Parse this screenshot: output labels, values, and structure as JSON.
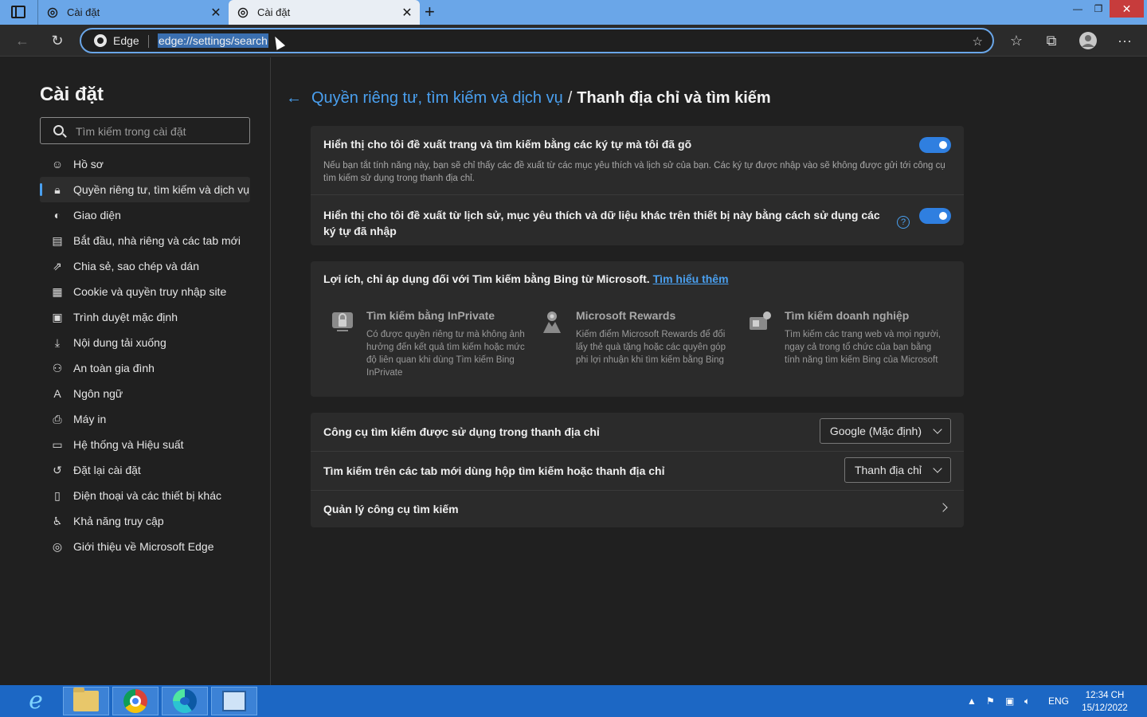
{
  "browser": {
    "tabs": [
      {
        "title": "Cài đặt",
        "active": false
      },
      {
        "title": "Cài đặt",
        "active": true
      }
    ],
    "address": {
      "brand": "Edge",
      "url": "edge://settings/search"
    }
  },
  "sidebar": {
    "title": "Cài đặt",
    "search_placeholder": "Tìm kiếm trong cài đặt",
    "items": [
      {
        "label": "Hồ sơ",
        "icon": "profile-icon"
      },
      {
        "label": "Quyền riêng tư, tìm kiếm và dịch vụ",
        "icon": "lock-icon",
        "selected": true
      },
      {
        "label": "Giao diện",
        "icon": "palette-icon"
      },
      {
        "label": "Bắt đầu, nhà riêng và các tab mới",
        "icon": "start-page-icon"
      },
      {
        "label": "Chia sẻ, sao chép và dán",
        "icon": "share-icon"
      },
      {
        "label": "Cookie và quyền truy nhập site",
        "icon": "cookie-icon"
      },
      {
        "label": "Trình duyệt mặc định",
        "icon": "default-browser-icon"
      },
      {
        "label": "Nội dung tải xuống",
        "icon": "download-icon"
      },
      {
        "label": "An toàn gia đình",
        "icon": "family-icon"
      },
      {
        "label": "Ngôn ngữ",
        "icon": "language-icon"
      },
      {
        "label": "Máy in",
        "icon": "printer-icon"
      },
      {
        "label": "Hệ thống và Hiệu suất",
        "icon": "laptop-icon"
      },
      {
        "label": "Đặt lại cài đặt",
        "icon": "reset-icon"
      },
      {
        "label": "Điện thoại và các thiết bị khác",
        "icon": "phone-icon"
      },
      {
        "label": "Khả năng truy cập",
        "icon": "accessibility-icon"
      },
      {
        "label": "Giới thiệu về Microsoft Edge",
        "icon": "edge-logo-icon"
      }
    ]
  },
  "main": {
    "breadcrumb": {
      "parent": "Quyền riêng tư, tìm kiếm và dịch vụ",
      "separator": "/",
      "current": "Thanh địa chỉ và tìm kiếm"
    },
    "suggestions": [
      {
        "title": "Hiển thị cho tôi đề xuất trang và tìm kiếm bằng các ký tự mà tôi đã gõ",
        "description": "Nếu bạn tắt tính năng này, bạn sẽ chỉ thấy các đề xuất từ các mục yêu thích và lịch sử của bạn. Các ký tự được nhập vào sẽ không được gửi tới công cụ tìm kiếm sử dụng trong thanh địa chỉ.",
        "enabled": true
      },
      {
        "title": "Hiển thị cho tôi đề xuất từ lịch sử, mục yêu thích và dữ liệu khác trên thiết bị này bằng cách sử dụng các ký tự đã nhập",
        "help": "?",
        "enabled": true
      }
    ],
    "benefits": {
      "title": "Lợi ích, chỉ áp dụng đối với Tìm kiếm bằng Bing từ Microsoft.",
      "link": "Tìm hiểu thêm",
      "features": [
        {
          "title": "Tìm kiếm bằng InPrivate",
          "description": "Có được quyền riêng tư mà không ảnh hưởng đến kết quả tìm kiếm hoặc mức độ liên quan khi dùng Tìm kiếm Bing InPrivate",
          "icon": "inprivate-icon"
        },
        {
          "title": "Microsoft Rewards",
          "description": "Kiếm điểm Microsoft Rewards để đổi lấy thẻ quà tặng hoặc các quyên góp phi lợi nhuận khi tìm kiếm bằng Bing",
          "icon": "rewards-icon"
        },
        {
          "title": "Tìm kiếm doanh nghiệp",
          "description": "Tìm kiếm các trang web và mọi người, ngay cả trong tổ chức của bạn bằng tính năng tìm kiếm Bing của Microsoft",
          "icon": "enterprise-search-icon"
        }
      ]
    },
    "engine_rows": [
      {
        "label": "Công cụ tìm kiếm được sử dụng trong thanh địa chỉ",
        "value": "Google (Mặc định)"
      },
      {
        "label": "Tìm kiếm trên các tab mới dùng hộp tìm kiếm hoặc thanh địa chỉ",
        "value": "Thanh địa chỉ"
      },
      {
        "label": "Quản lý công cụ tìm kiếm"
      }
    ]
  },
  "taskbar": {
    "language": "ENG",
    "time": "12:34 CH",
    "date": "15/12/2022"
  },
  "colors": {
    "accent": "#4aa0f0",
    "toggle_on": "#2f7fe0",
    "taskbar": "#1c67c4",
    "tabstrip": "#6aa6e8"
  }
}
